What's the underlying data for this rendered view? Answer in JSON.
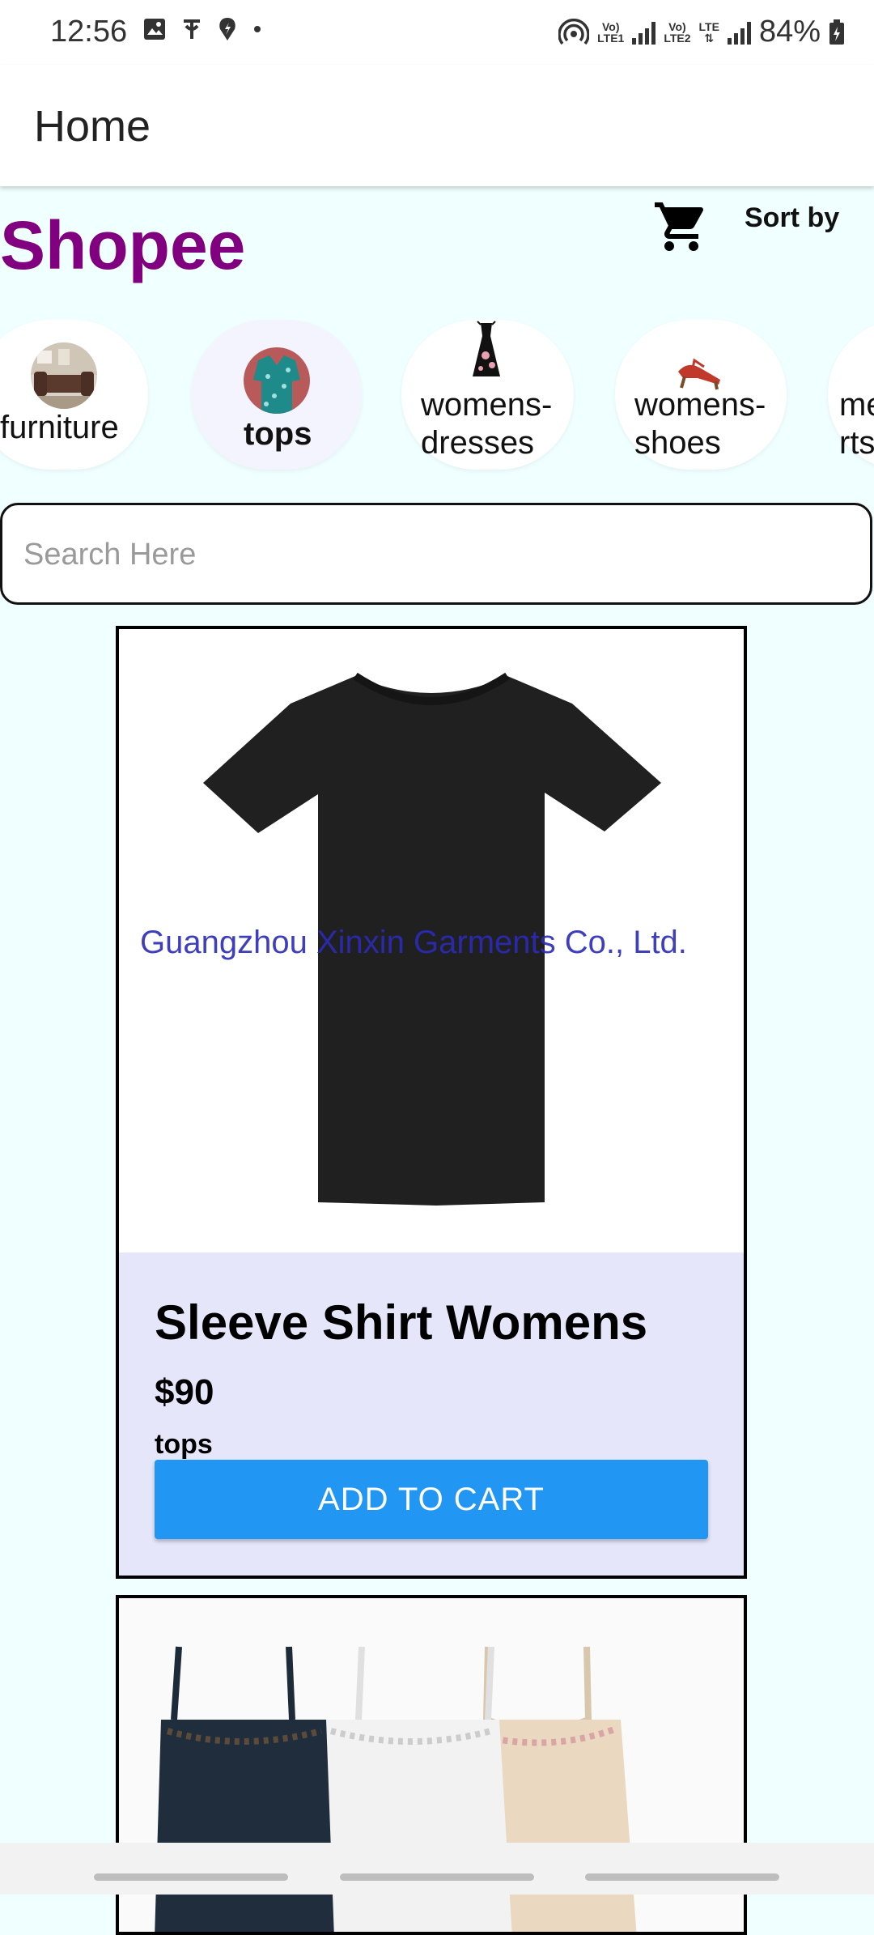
{
  "status_bar": {
    "time": "12:56",
    "battery": "84%",
    "net1": "LTE1",
    "net2": "LTE2",
    "volte": "Vo)",
    "lte": "LTE"
  },
  "app_bar": {
    "title": "Home"
  },
  "header": {
    "brand": "Shopee",
    "sort_label": "Sort by",
    "cart_icon": "shopping-cart-icon"
  },
  "categories": [
    {
      "label": "furniture"
    },
    {
      "label": "tops",
      "selected": true
    },
    {
      "label_line1": "womens-",
      "label_line2": "dresses"
    },
    {
      "label_line1": "womens-",
      "label_line2": "shoes"
    },
    {
      "label_line1": "me",
      "label_line2": "rts"
    }
  ],
  "search": {
    "placeholder": "Search Here"
  },
  "products": [
    {
      "name": "Sleeve Shirt Womens",
      "price": "$90",
      "category": "tops",
      "button_label": "ADD TO CART",
      "watermark": "Guangzhou Xinxin Garments Co., Ltd."
    },
    {
      "image": "camisoles-photo"
    }
  ],
  "colors": {
    "brand": "#800080",
    "background": "#F0FFFF",
    "button": "#2196F3",
    "card_info": "#E6E6FA"
  }
}
